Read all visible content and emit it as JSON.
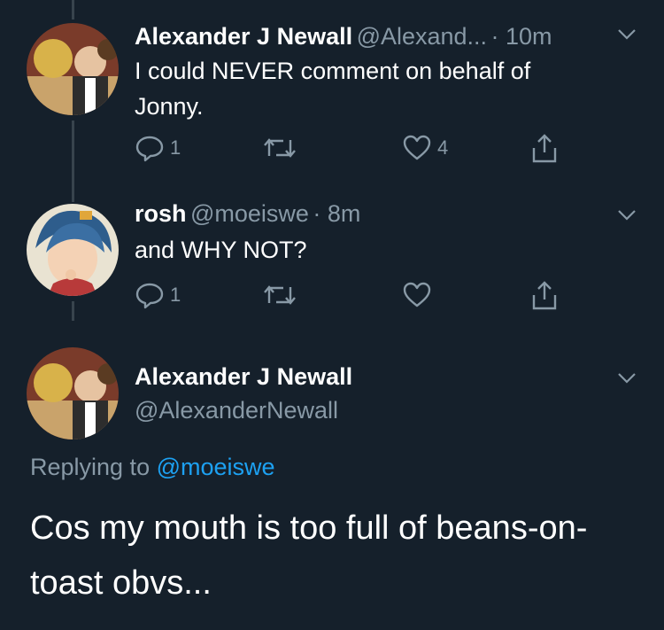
{
  "tweets": [
    {
      "name": "Alexander J Newall",
      "handle": "@Alexand...",
      "time": "· 10m",
      "text_lines": [
        "I could NEVER comment on behalf of",
        "Jonny."
      ],
      "replies": "1",
      "retweets": "",
      "likes": "4"
    },
    {
      "name": "rosh",
      "handle": "@moeiswe",
      "time": "· 8m",
      "text_lines": [
        "and WHY NOT?"
      ],
      "replies": "1",
      "retweets": "",
      "likes": ""
    }
  ],
  "main_tweet": {
    "name": "Alexander J Newall",
    "handle": "@AlexanderNewall",
    "replying_prefix": "Replying to",
    "replying_to": "@moeiswe",
    "text": "Cos my mouth is too full of beans-on-toast obvs..."
  },
  "colors": {
    "background": "#15202b",
    "text": "#ffffff",
    "secondary": "#8899a6",
    "link": "#1da1f2",
    "thread_line": "#38444d"
  },
  "icons": [
    "reply-icon",
    "retweet-icon",
    "like-icon",
    "share-icon",
    "chevron-down-icon"
  ]
}
